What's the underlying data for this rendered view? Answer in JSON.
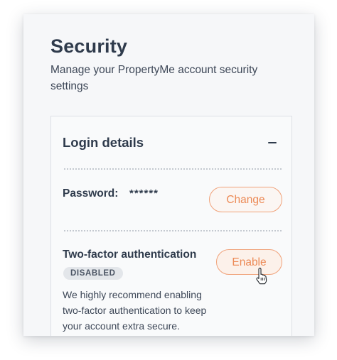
{
  "page": {
    "title": "Security",
    "subtitle": "Manage your PropertyMe account security settings"
  },
  "login_details": {
    "title": "Login details",
    "collapse_icon": "minus-icon",
    "password": {
      "label": "Password:",
      "value": "******",
      "button_label": "Change"
    },
    "two_factor": {
      "label": "Two-factor authentication",
      "status": "DISABLED",
      "button_label": "Enable",
      "description": "We highly recommend enabling two-factor authentication to keep your account extra secure."
    }
  },
  "cursor": {
    "icon": "hand-pointer-icon"
  },
  "colors": {
    "heading": "#2f3b4c",
    "accent": "#ec8a56",
    "accent_border": "#f0a27a",
    "badge_bg": "#e3e6ea",
    "panel_bg": "#f6f7f9"
  }
}
